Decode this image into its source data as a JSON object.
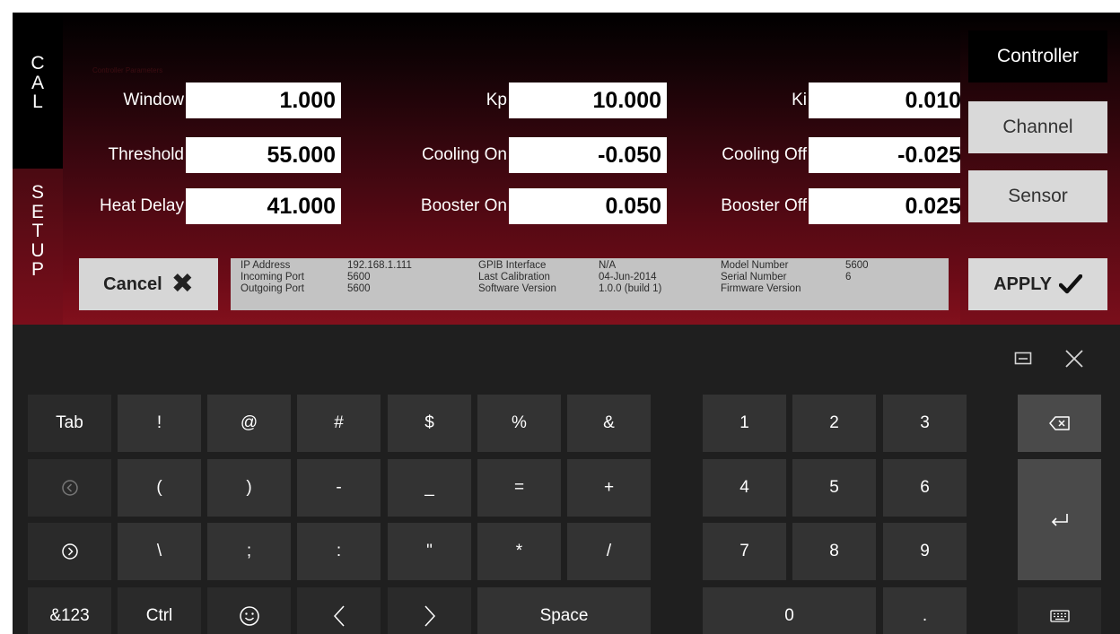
{
  "side_tabs": {
    "cal": [
      "C",
      "A",
      "L"
    ],
    "setup": [
      "S",
      "E",
      "T",
      "U",
      "P"
    ]
  },
  "section_title": "Controller Parameters",
  "params": {
    "window": {
      "label": "Window",
      "value": "1.000"
    },
    "threshold": {
      "label": "Threshold",
      "value": "55.000"
    },
    "heat_delay": {
      "label": "Heat Delay",
      "value": "41.000"
    },
    "kp": {
      "label": "Kp",
      "value": "10.000"
    },
    "cooling_on": {
      "label": "Cooling On",
      "value": "-0.050"
    },
    "booster_on": {
      "label": "Booster On",
      "value": "0.050"
    },
    "ki": {
      "label": "Ki",
      "value": "0.010"
    },
    "cooling_off": {
      "label": "Cooling Off",
      "value": "-0.025"
    },
    "booster_off": {
      "label": "Booster Off",
      "value": "0.025"
    }
  },
  "cancel": {
    "label": "Cancel",
    "icon": "close-icon"
  },
  "info": {
    "col1": {
      "labels": [
        "IP Address",
        "Incoming Port",
        "Outgoing Port"
      ],
      "values": [
        "192.168.1.111",
        "5600",
        "5600"
      ]
    },
    "col2": {
      "labels": [
        "GPIB Interface",
        "Last Calibration",
        "Software Version"
      ],
      "values": [
        "N/A",
        "04-Jun-2014",
        "1.0.0 (build 1)"
      ]
    },
    "col3": {
      "labels": [
        "Model Number",
        "Serial Number",
        "Firmware Version"
      ],
      "values": [
        "5600",
        "6",
        ""
      ]
    }
  },
  "nav": {
    "controller": "Controller",
    "channel": "Channel",
    "sensor": "Sensor"
  },
  "apply": {
    "label": "APPLY",
    "icon": "checkmark-icon"
  },
  "keyboard": {
    "row1": [
      "Tab",
      "!",
      "@",
      "#",
      "$",
      "%",
      "&"
    ],
    "row2": [
      "(",
      ")",
      "-",
      "_",
      "=",
      "+"
    ],
    "row3": [
      "\\",
      ";",
      ":",
      "\"",
      "*",
      "/"
    ],
    "row4_ctrl": [
      "&123",
      "Ctrl"
    ],
    "space": "Space",
    "numpad": [
      "1",
      "2",
      "3",
      "4",
      "5",
      "6",
      "7",
      "8",
      "9",
      "0",
      "."
    ]
  },
  "colors": {
    "panel_dark": "#000000",
    "panel_red": "#7a0e1b",
    "key_bg": "#333333",
    "keyboard_bg": "#1f1f1f",
    "button_bg": "#d9d9d9"
  }
}
